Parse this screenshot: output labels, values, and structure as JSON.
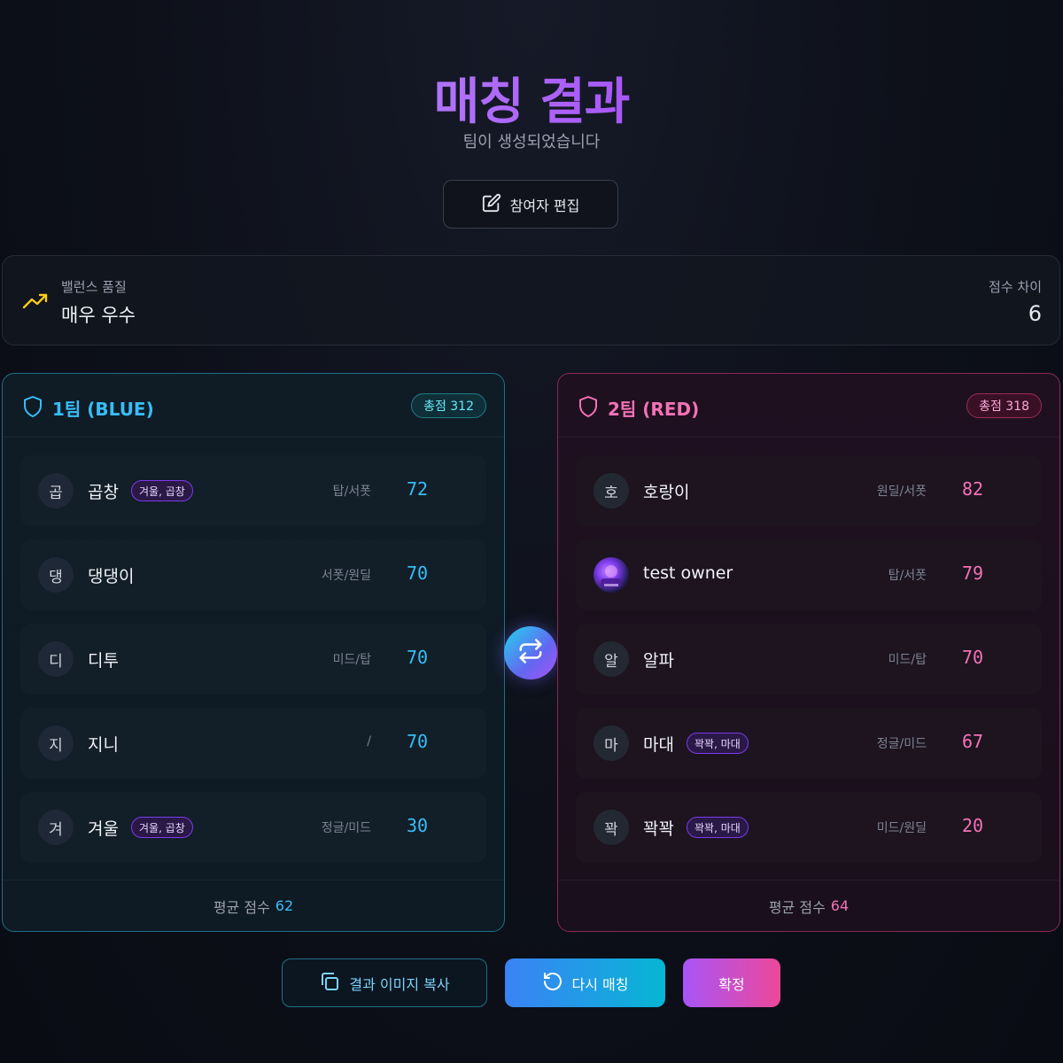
{
  "header": {
    "title": "매칭 결과",
    "subtitle": "팀이 생성되었습니다",
    "edit_button": "참여자 편집"
  },
  "balance": {
    "label": "밸런스 품질",
    "value": "매우 우수",
    "diff_label": "점수 차이",
    "diff_value": "6",
    "icon": "trending-up-icon"
  },
  "teams": [
    {
      "name": "1팀 (BLUE)",
      "total": "총점 312",
      "avg_label": "평균 점수",
      "avg_value": "62",
      "players": [
        {
          "initial": "곱",
          "name": "곱창",
          "tag": "겨울, 곱창",
          "pos": "탑/서폿",
          "score": "72"
        },
        {
          "initial": "댕",
          "name": "댕댕이",
          "tag": "",
          "pos": "서폿/원딜",
          "score": "70"
        },
        {
          "initial": "디",
          "name": "디투",
          "tag": "",
          "pos": "미드/탑",
          "score": "70"
        },
        {
          "initial": "지",
          "name": "지니",
          "tag": "",
          "pos": "/",
          "score": "70"
        },
        {
          "initial": "겨",
          "name": "겨울",
          "tag": "겨울, 곱창",
          "pos": "정글/미드",
          "score": "30"
        }
      ]
    },
    {
      "name": "2팀 (RED)",
      "total": "총점 318",
      "avg_label": "평균 점수",
      "avg_value": "64",
      "players": [
        {
          "initial": "호",
          "name": "호랑이",
          "tag": "",
          "pos": "원딜/서폿",
          "score": "82"
        },
        {
          "initial": "",
          "name": "test owner",
          "tag": "",
          "pos": "탑/서폿",
          "score": "79"
        },
        {
          "initial": "알",
          "name": "알파",
          "tag": "",
          "pos": "미드/탑",
          "score": "70"
        },
        {
          "initial": "마",
          "name": "마대",
          "tag": "꽉꽉, 마대",
          "pos": "정글/미드",
          "score": "67"
        },
        {
          "initial": "꽉",
          "name": "꽉꽉",
          "tag": "꽉꽉, 마대",
          "pos": "미드/원딜",
          "score": "20"
        }
      ]
    }
  ],
  "actions": {
    "copy": "결과 이미지 복사",
    "rematch": "다시 매칭",
    "confirm": "확정"
  },
  "colors": {
    "blue_accent": "#38bdf8",
    "red_accent": "#f472b6",
    "title_gradient": "#a855f7"
  }
}
